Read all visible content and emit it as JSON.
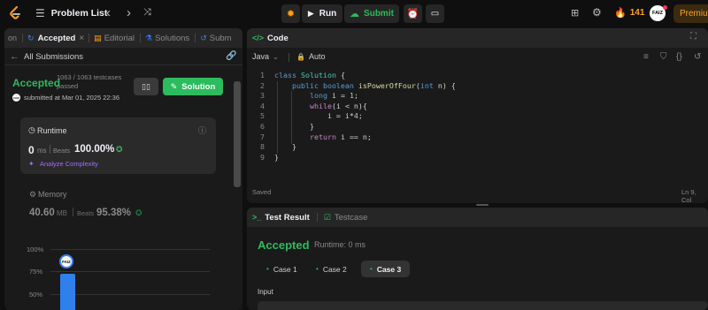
{
  "topbar": {
    "problem_list": "Problem List",
    "run": "Run",
    "submit": "Submit",
    "streak": "141",
    "avatar": "FAIZ",
    "premium": "Premiu"
  },
  "left": {
    "tabs": [
      {
        "label": "on"
      },
      {
        "label": "Accepted"
      },
      {
        "label": "Editorial"
      },
      {
        "label": "Solutions"
      },
      {
        "label": "Subm"
      }
    ],
    "all_submissions": "All Submissions",
    "status": "Accepted",
    "testcases": "1063 / 1063 testcases",
    "testcases_2": "passed",
    "submitted": "submitted at Mar 01, 2025 22:36",
    "avatar": "FAIZ",
    "solution_btn": "Solution",
    "runtime": {
      "title": "Runtime",
      "value": "0",
      "unit": "ms",
      "beats_label": "Beats",
      "beats": "100.00%",
      "analyze": "Analyze Complexity"
    },
    "memory": {
      "title": "Memory",
      "value": "40.60",
      "unit": "MB",
      "beats_label": "Beats",
      "beats": "95.38%"
    },
    "chart": {
      "ticks": [
        "100%",
        "75%",
        "50%"
      ],
      "avatar": "FAIZ"
    }
  },
  "code": {
    "title": "Code",
    "language": "Java",
    "auto": "Auto",
    "saved": "Saved",
    "cursor": "Ln 9, Col",
    "line_numbers": [
      "1",
      "2",
      "3",
      "4",
      "5",
      "6",
      "7",
      "8",
      "9"
    ]
  },
  "test": {
    "tab_result": "Test Result",
    "tab_testcase": "Testcase",
    "status": "Accepted",
    "runtime": "Runtime: 0 ms",
    "cases": [
      "Case 1",
      "Case 2",
      "Case 3"
    ],
    "input_label": "Input"
  },
  "colors": {
    "accent_green": "#2cbb5d",
    "brand_orange": "#ffa116",
    "panel": "#1a1a1a",
    "background": "#0f0f0f"
  }
}
